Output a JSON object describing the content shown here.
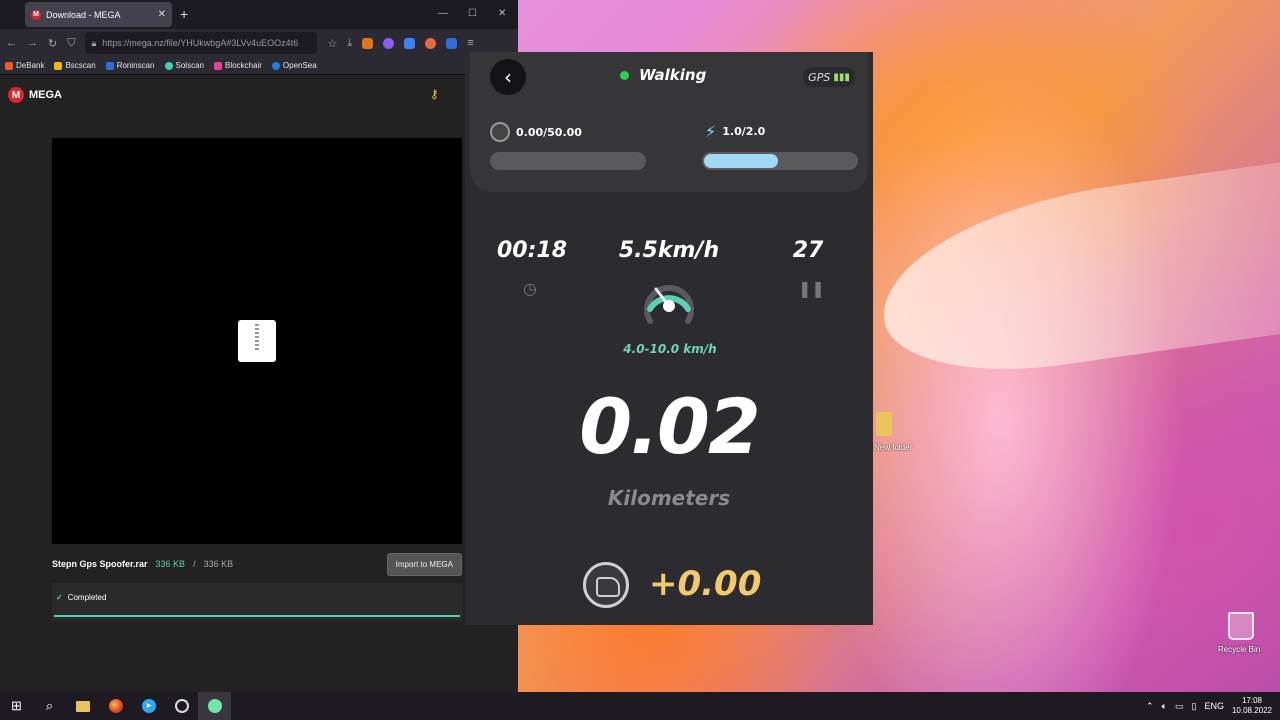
{
  "browser": {
    "tab_title": "Download - MEGA",
    "url": "https://mega.nz/file/YHUkwbgA#3LVv4uEOOz4t6",
    "bookmarks": [
      "DeBank",
      "Bscscan",
      "Roninscan",
      "Solscan",
      "Blockchair",
      "OpenSea"
    ]
  },
  "mega": {
    "logo": "MEGA",
    "file_name": "Stepn Gps Spoofer.rar",
    "downloaded": "336 KB",
    "separator": "/",
    "total": "336 KB",
    "import_label": "Import to MEGA",
    "status": "Completed"
  },
  "app": {
    "mode": "Walking",
    "gps_label": "GPS",
    "energy_counter": "0.00/50.00",
    "energy_value": "1.0/2.0",
    "energy_fill": 0.5,
    "time": "00:18",
    "speed": "5.5km/h",
    "steps": "27",
    "speed_range": "4.0-10.0 km/h",
    "distance": "0.02",
    "distance_unit": "Kilometers",
    "earnings": "+0.00"
  },
  "desktop": {
    "folder_label": "New folder",
    "recycle_label": "Recycle Bin"
  },
  "taskbar": {
    "lang": "ENG",
    "time": "17:08",
    "date": "10.08.2022"
  },
  "colors": {
    "accent_green": "#5ccfb4",
    "bar_fill": "#9fd9f5",
    "earnings_gold": "#f2c96b",
    "mega_red": "#d9272e"
  }
}
